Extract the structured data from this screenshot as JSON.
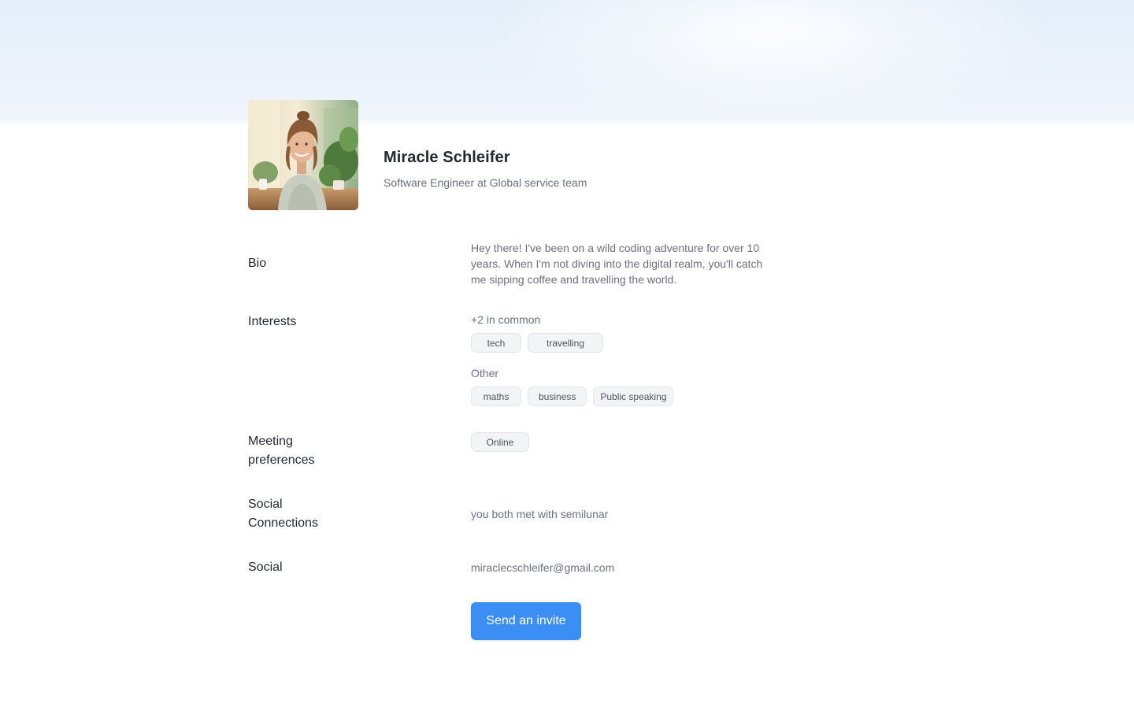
{
  "profile": {
    "name": "Miracle Schleifer",
    "title": "Software Engineer at Global service team"
  },
  "bio": {
    "label": "Bio",
    "text": "Hey there! I've been on a wild coding adventure for over 10 years. When I'm not diving into the digital realm, you'll catch me sipping coffee and travelling the world."
  },
  "interests": {
    "label": "Interests",
    "common_heading": "+2 in common",
    "common": [
      "tech",
      "travelling"
    ],
    "other_heading": "Other",
    "other": [
      "maths",
      "business",
      "Public speaking"
    ]
  },
  "meeting": {
    "label_line1": "Meeting",
    "label_line2": "preferences",
    "options": [
      "Online"
    ]
  },
  "social_connections": {
    "label_line1": "Social",
    "label_line2": "Connections",
    "text": "you both met with semilunar"
  },
  "social": {
    "label": "Social",
    "email": "miraclecschleifer@gmail.com"
  },
  "actions": {
    "invite_label": "Send an invite"
  },
  "colors": {
    "accent": "#3b8ef3",
    "hero_bg": "#e4eef9",
    "chip_bg": "#f3f4f6"
  }
}
